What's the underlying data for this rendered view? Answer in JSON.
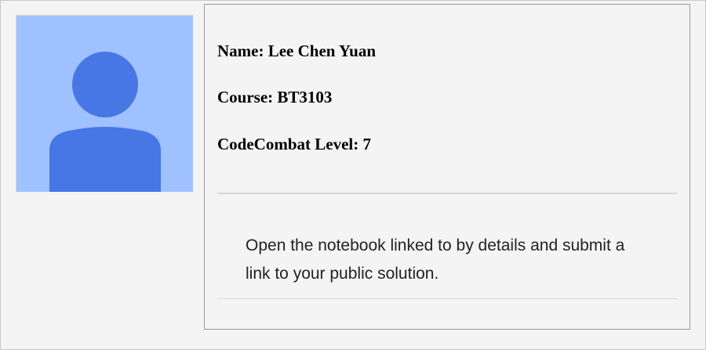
{
  "profile": {
    "name_line": "Name: Lee Chen Yuan",
    "course_line": "Course: BT3103",
    "level_line": "CodeCombat Level: 7",
    "avatar_icon": "person-placeholder-icon"
  },
  "assignment": {
    "message": "Open the notebook linked to by details and submit a link to your public solution."
  },
  "scrollbar": {
    "up_icon": "scroll-up-arrow-icon",
    "down_icon": "scroll-down-arrow-icon"
  },
  "colors": {
    "avatar_background": "#a0c1ff",
    "avatar_figure": "#4677e4",
    "page_background": "#f4f4f4"
  }
}
